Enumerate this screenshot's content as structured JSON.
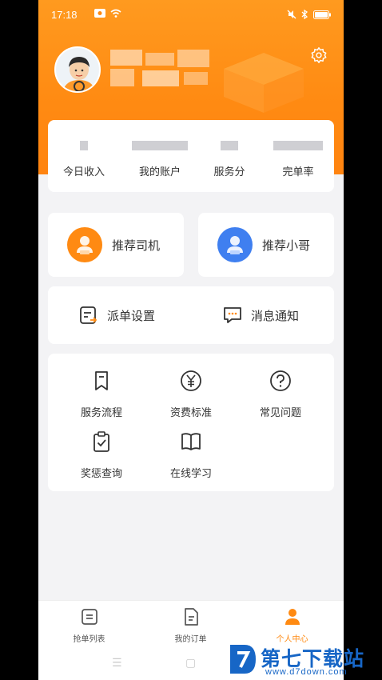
{
  "status_bar": {
    "time": "17:18"
  },
  "stats": [
    {
      "label": "今日收入"
    },
    {
      "label": "我的账户"
    },
    {
      "label": "服务分"
    },
    {
      "label": "完单率"
    }
  ],
  "referrals": [
    {
      "label": "推荐司机",
      "color": "#ff8a12"
    },
    {
      "label": "推荐小哥",
      "color": "#3f7ff0"
    }
  ],
  "settings_row": [
    {
      "label": "派单设置",
      "icon": "dispatch-icon"
    },
    {
      "label": "消息通知",
      "icon": "message-icon"
    }
  ],
  "grid": [
    {
      "label": "服务流程",
      "icon": "bookmark-icon"
    },
    {
      "label": "资费标准",
      "icon": "yen-icon"
    },
    {
      "label": "常见问题",
      "icon": "question-icon"
    },
    {
      "label": "奖惩查询",
      "icon": "clipboard-check-icon"
    },
    {
      "label": "在线学习",
      "icon": "book-icon"
    }
  ],
  "tabs": [
    {
      "label": "抢单列表",
      "active": false
    },
    {
      "label": "我的订单",
      "active": false
    },
    {
      "label": "个人中心",
      "active": true
    }
  ],
  "watermark": {
    "title": "第七下载站",
    "url": "www.d7down.com"
  },
  "colors": {
    "accent": "#ff8a12",
    "blue": "#3f7ff0"
  }
}
